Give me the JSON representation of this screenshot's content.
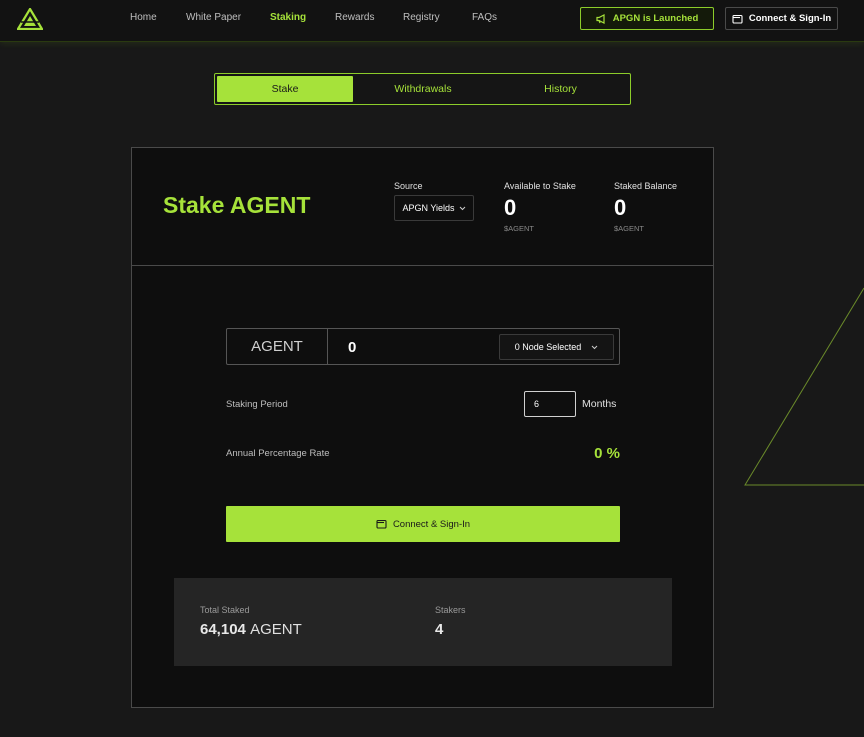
{
  "nav": {
    "items": [
      "Home",
      "White Paper",
      "Staking",
      "Rewards",
      "Registry",
      "FAQs"
    ],
    "active": "Staking",
    "launch_label": "APGN is Launched",
    "connect_label": "Connect & Sign-In"
  },
  "tabs": [
    "Stake",
    "Withdrawals",
    "History"
  ],
  "card": {
    "title": "Stake AGENT",
    "source_label": "Source",
    "source_value": "APGN Yields",
    "available_label": "Available to Stake",
    "available_value": "0",
    "available_unit": "$AGENT",
    "staked_label": "Staked Balance",
    "staked_value": "0",
    "staked_unit": "$AGENT"
  },
  "form": {
    "token": "AGENT",
    "amount": "0",
    "node_select": "0 Node Selected",
    "period_label": "Staking Period",
    "period_value": "6",
    "period_unit": "Months",
    "apr_label": "Annual Percentage Rate",
    "apr_value": "0 %",
    "connect_label": "Connect & Sign-In"
  },
  "stats": {
    "total_label": "Total Staked",
    "total_value": "64,104",
    "total_unit": "AGENT",
    "stakers_label": "Stakers",
    "stakers_value": "4"
  },
  "colors": {
    "accent": "#a6e23a",
    "background": "#181818",
    "card": "#0e0e0e"
  }
}
